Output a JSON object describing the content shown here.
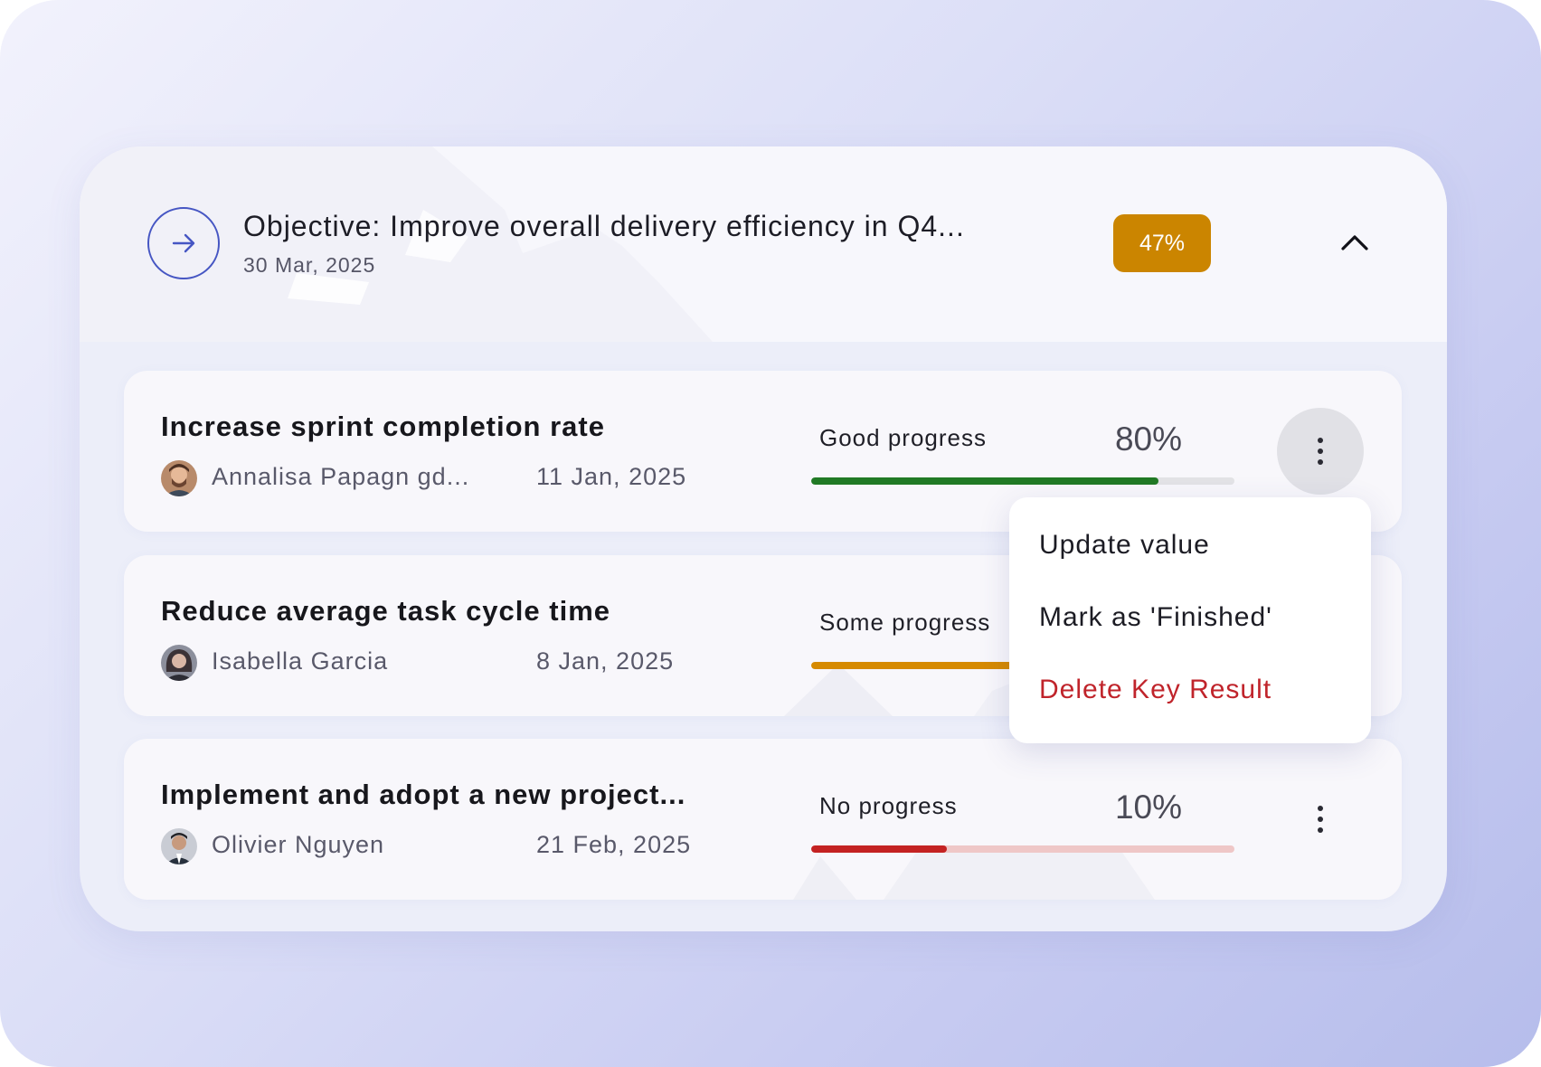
{
  "objective": {
    "title": "Objective: Improve overall delivery efficiency in Q4...",
    "date": "30 Mar, 2025",
    "progress_label": "47%",
    "progress": 0.47,
    "badge_color": "#cb8500",
    "accent_color": "#4656c3",
    "icons": {
      "open": "arrow-right-icon",
      "collapse": "chevron-up-icon"
    }
  },
  "key_results": [
    {
      "title": "Increase sprint completion rate",
      "owner": "Annalisa Papagn gd...",
      "date": "11 Jan, 2025",
      "status": "Good progress",
      "percent_label": "80%",
      "progress": 0.82,
      "fill_color": "#217a25",
      "track_color": "#e3e3e6",
      "menu_open": true
    },
    {
      "title": "Reduce average task cycle time",
      "owner": "Isabella Garcia",
      "date": "8 Jan, 2025",
      "status": "Some progress",
      "percent_label": "",
      "progress": 0.5,
      "fill_color": "#d68a00",
      "track_color": "#f3dfb7",
      "menu_open": false
    },
    {
      "title": "Implement and adopt a new project...",
      "owner": "Olivier Nguyen",
      "date": "21 Feb, 2025",
      "status": "No progress",
      "percent_label": "10%",
      "progress": 0.32,
      "fill_color": "#c42222",
      "track_color": "#efc7c7",
      "menu_open": false
    }
  ],
  "context_menu": {
    "items": [
      {
        "label": "Update value",
        "color": "#1c1c24"
      },
      {
        "label": "Mark as 'Finished'",
        "color": "#1c1c24"
      },
      {
        "label": "Delete Key Result",
        "color": "#c0242b"
      }
    ]
  }
}
